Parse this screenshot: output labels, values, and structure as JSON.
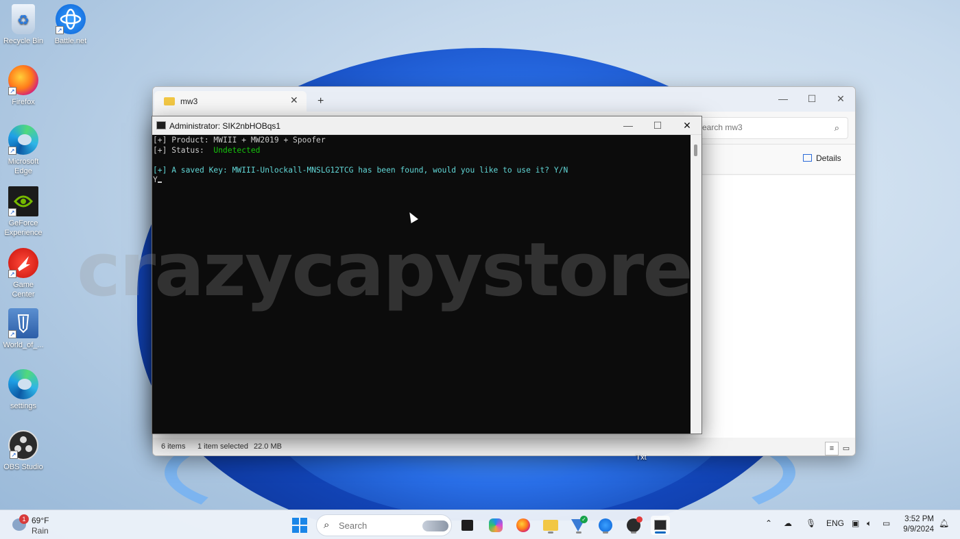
{
  "desktop": {
    "icons": [
      {
        "label": "Recycle Bin"
      },
      {
        "label": "Battle.net"
      },
      {
        "label": "Firefox"
      },
      {
        "label": "Microsoft Edge"
      },
      {
        "label": "GeForce Experience"
      },
      {
        "label": "Game Center"
      },
      {
        "label": "World_of_..."
      },
      {
        "label": "settings"
      },
      {
        "label": "OBS Studio"
      },
      {
        "label": "Txt"
      }
    ]
  },
  "explorer": {
    "tab_title": "mw3",
    "search_placeholder": "Search mw3",
    "details_label": "Details",
    "status_items": "6 items",
    "status_selected": "1 item selected",
    "status_size": "22.0 MB"
  },
  "console": {
    "title": "Administrator: SIK2nbHOBqs1",
    "lines": {
      "product_prefix": "[+] Product: ",
      "product_value": "MWIII + MW2019 + Spoofer",
      "status_prefix": "[+] Status:  ",
      "status_value": "Undetected",
      "key_prompt": "[+] A saved Key: MWIII-Unlockall-MNSLG12TCG has been found, would you like to use it? Y/N",
      "input": "Y"
    },
    "watermark": "crazycapystore"
  },
  "taskbar": {
    "weather_badge": "1",
    "weather_temp": "69°F",
    "weather_cond": "Rain",
    "search_placeholder": "Search",
    "language": "ENG",
    "time": "3:52 PM",
    "date": "9/9/2024"
  },
  "colors": {
    "status_green": "#16c60c",
    "prompt_cyan": "#61d6d6",
    "accent": "#0067c0"
  }
}
